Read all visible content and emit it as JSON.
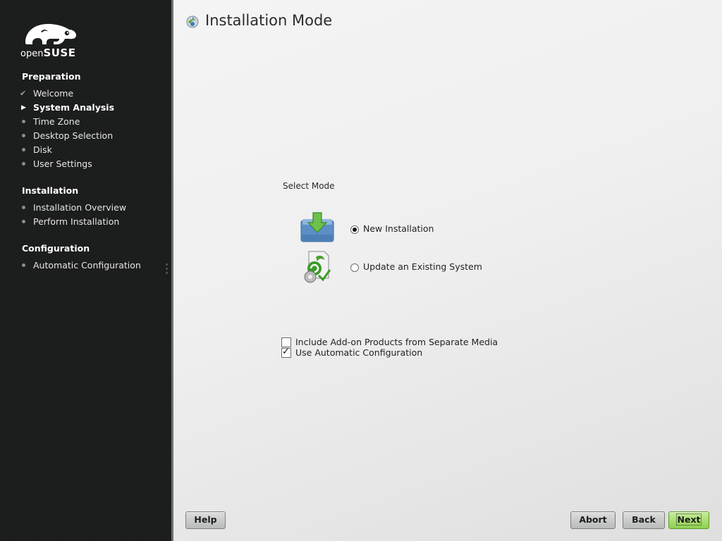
{
  "app": {
    "logo_text_thin": "open",
    "logo_text_bold": "SUSE",
    "colors": {
      "sidebar_bg": "#1b1c1c",
      "accent_green": "#8fd04f",
      "main_bg": "#efefef"
    }
  },
  "sidebar": {
    "sections": [
      {
        "title": "Preparation",
        "steps": [
          {
            "label": "Welcome",
            "state": "done"
          },
          {
            "label": "System Analysis",
            "state": "current"
          },
          {
            "label": "Time Zone",
            "state": "pending"
          },
          {
            "label": "Desktop Selection",
            "state": "pending"
          },
          {
            "label": "Disk",
            "state": "pending"
          },
          {
            "label": "User Settings",
            "state": "pending"
          }
        ]
      },
      {
        "title": "Installation",
        "steps": [
          {
            "label": "Installation Overview",
            "state": "pending"
          },
          {
            "label": "Perform Installation",
            "state": "pending"
          }
        ]
      },
      {
        "title": "Configuration",
        "steps": [
          {
            "label": "Automatic Configuration",
            "state": "pending"
          }
        ]
      }
    ]
  },
  "main": {
    "title": "Installation Mode",
    "title_icon": "yast-installation-icon",
    "select_mode_label": "Select Mode",
    "modes": [
      {
        "label": "New Installation",
        "icon": "download-folder-icon",
        "selected": true
      },
      {
        "label": "Update an Existing System",
        "icon": "update-system-icon",
        "selected": false
      }
    ],
    "options": [
      {
        "label": "Include Add-on Products from Separate Media",
        "checked": false
      },
      {
        "label": "Use Automatic Configuration",
        "checked": true
      }
    ]
  },
  "buttons": {
    "help": "Help",
    "abort": "Abort",
    "back": "Back",
    "next": "Next"
  }
}
